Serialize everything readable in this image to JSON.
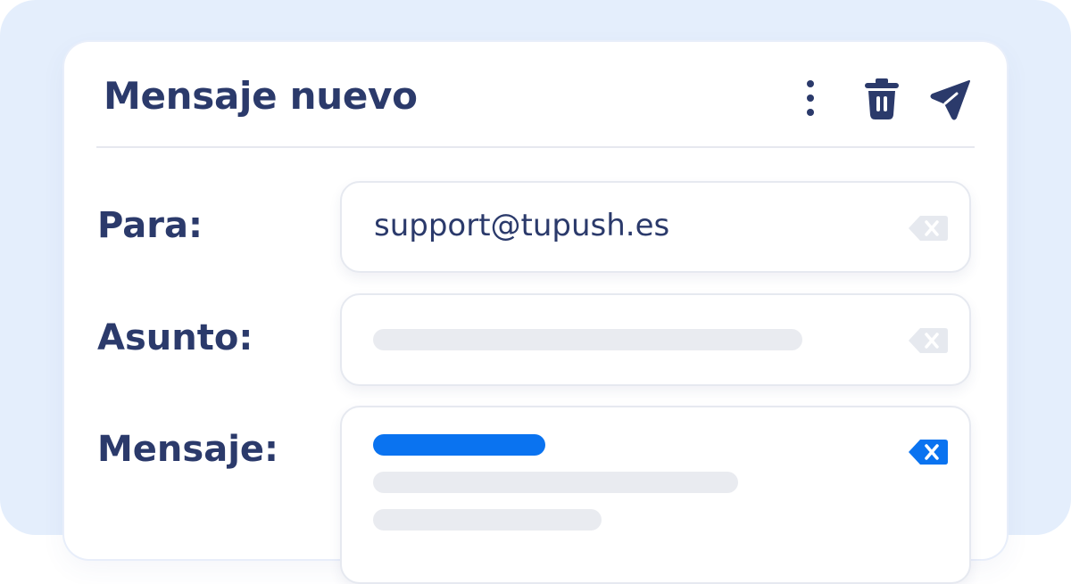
{
  "compose": {
    "title": "Mensaje nuevo",
    "toolbar": {
      "more_icon": "more-vertical-icon",
      "delete_icon": "trash-icon",
      "send_icon": "send-icon"
    },
    "fields": {
      "to": {
        "label": "Para:",
        "value": "support@tupush.es",
        "clear_icon": "backspace-icon"
      },
      "subject": {
        "label": "Asunto:",
        "value": "",
        "clear_icon": "backspace-icon"
      },
      "message": {
        "label": "Mensaje:",
        "value": "",
        "clear_icon": "backspace-icon"
      }
    }
  },
  "colors": {
    "text": "#2b3a6b",
    "accent": "#0a73f0",
    "placeholder_bar": "#e9ebf0",
    "background": "#e4eefc"
  }
}
